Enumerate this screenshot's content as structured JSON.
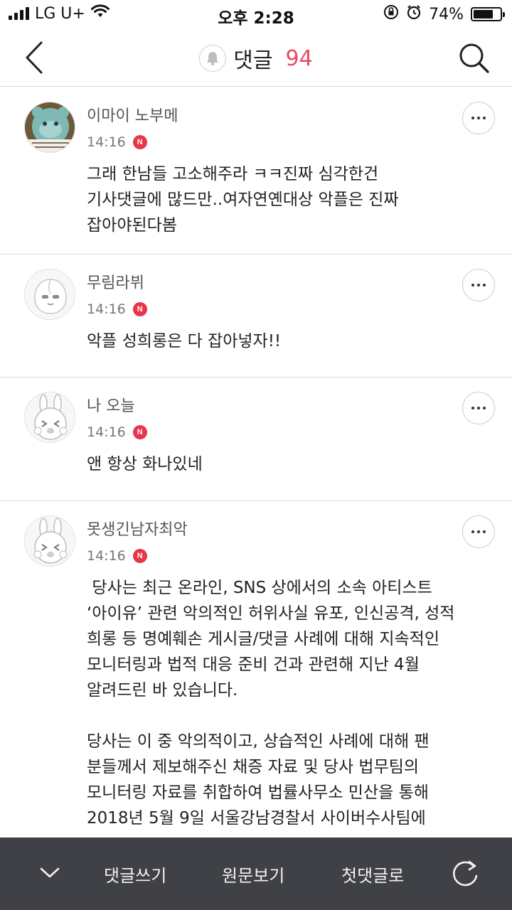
{
  "status_bar": {
    "carrier": "LG U+",
    "time": "오후 2:28",
    "battery": "74%",
    "battery_level": 0.74
  },
  "header": {
    "title": "댓글",
    "count": "94",
    "back_icon": "chevron-left-icon",
    "bell_icon": "bell-icon",
    "search_icon": "search-icon",
    "accent": "#e84a5f"
  },
  "comments": [
    {
      "nickname": "이마이 노부메",
      "time": "14:16",
      "badge": "N",
      "text": "그래 한남들 고소해주라 ㅋㅋ진짜 심각한건\n기사댓글에 많드만..여자연옌대상 악플은 진짜\n잡아야된다봄"
    },
    {
      "nickname": "무림라뷔",
      "time": "14:16",
      "badge": "N",
      "text": "악플 성희롱은 다 잡아넣자!!"
    },
    {
      "nickname": "나 오늘",
      "time": "14:16",
      "badge": "N",
      "text": "앤 항상 화나있네"
    },
    {
      "nickname": "못생긴남자최악",
      "time": "14:16",
      "badge": "N",
      "text": " 당사는 최근 온라인, SNS 상에서의 소속 아티스트\n‘아이유’ 관련 악의적인 허위사실 유포, 인신공격, 성적\n희롱 등 명예훼손 게시글/댓글 사례에 대해 지속적인\n모니터링과 법적 대응 준비 건과 관련해 지난 4월\n알려드린 바 있습니다.\n\n당사는 이 중 악의적이고, 상습적인 사례에 대해 팬\n분들께서 제보해주신 채증 자료 및 당사 법무팀의\n모니터링 자료를 취합하여 법률사무소 민산을 통해\n2018년 5월 9일 서울강남경찰서 사이버수사팀에"
    }
  ],
  "bottom_bar": {
    "collapse_icon": "chevron-down-icon",
    "write": "댓글쓰기",
    "original": "원문보기",
    "first": "첫댓글로",
    "refresh_icon": "refresh-icon"
  }
}
